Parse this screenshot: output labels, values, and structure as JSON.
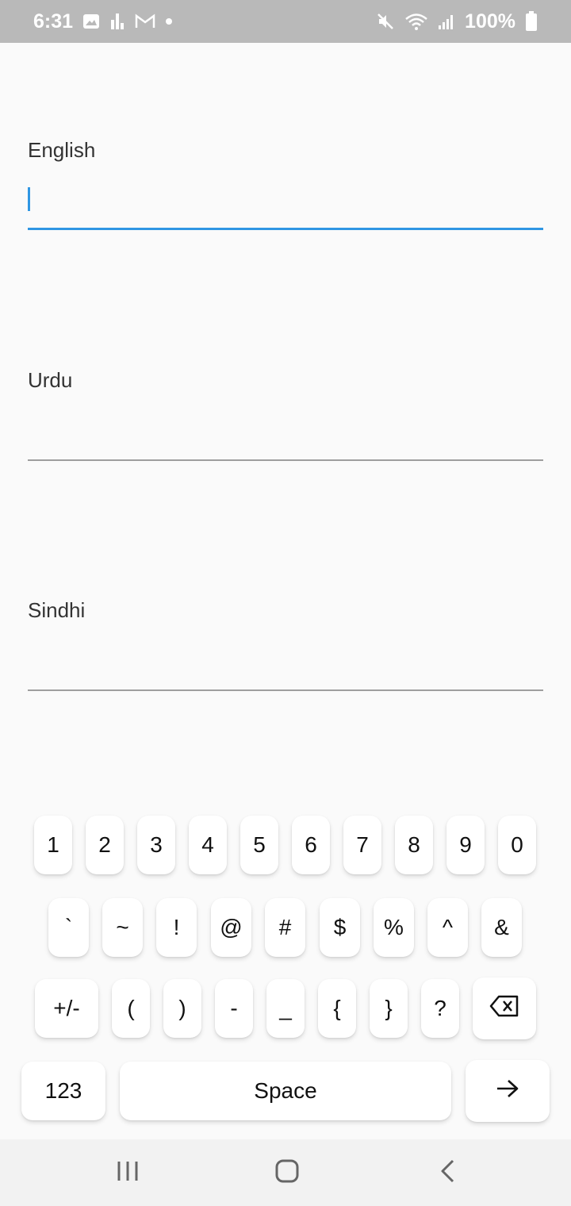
{
  "status_bar": {
    "time": "6:31",
    "battery": "100%",
    "icons": [
      "image-icon",
      "signal-bars-icon",
      "gmail-icon",
      "dot-icon",
      "mute-icon",
      "wifi-icon",
      "cell-signal-icon",
      "battery-icon"
    ]
  },
  "form": {
    "english": {
      "label": "English",
      "value": ""
    },
    "urdu": {
      "label": "Urdu",
      "value": ""
    },
    "sindhi": {
      "label": "Sindhi",
      "value": ""
    }
  },
  "keyboard": {
    "row1": [
      "1",
      "2",
      "3",
      "4",
      "5",
      "6",
      "7",
      "8",
      "9",
      "0"
    ],
    "row2": [
      "`",
      "~",
      "!",
      "@",
      "#",
      "$",
      "%",
      "^",
      "&"
    ],
    "row3": [
      "+/-",
      "(",
      ")",
      "-",
      "_",
      "{",
      "}",
      "?"
    ],
    "mode_key": "123",
    "space_key": "Space",
    "icons": {
      "backspace": "backspace-icon",
      "enter": "arrow-right-icon"
    }
  },
  "nav": {
    "icons": [
      "recents-icon",
      "home-icon",
      "back-icon"
    ]
  },
  "colors": {
    "accent": "#2f96e3",
    "status_bar": "#b9b9b9"
  }
}
